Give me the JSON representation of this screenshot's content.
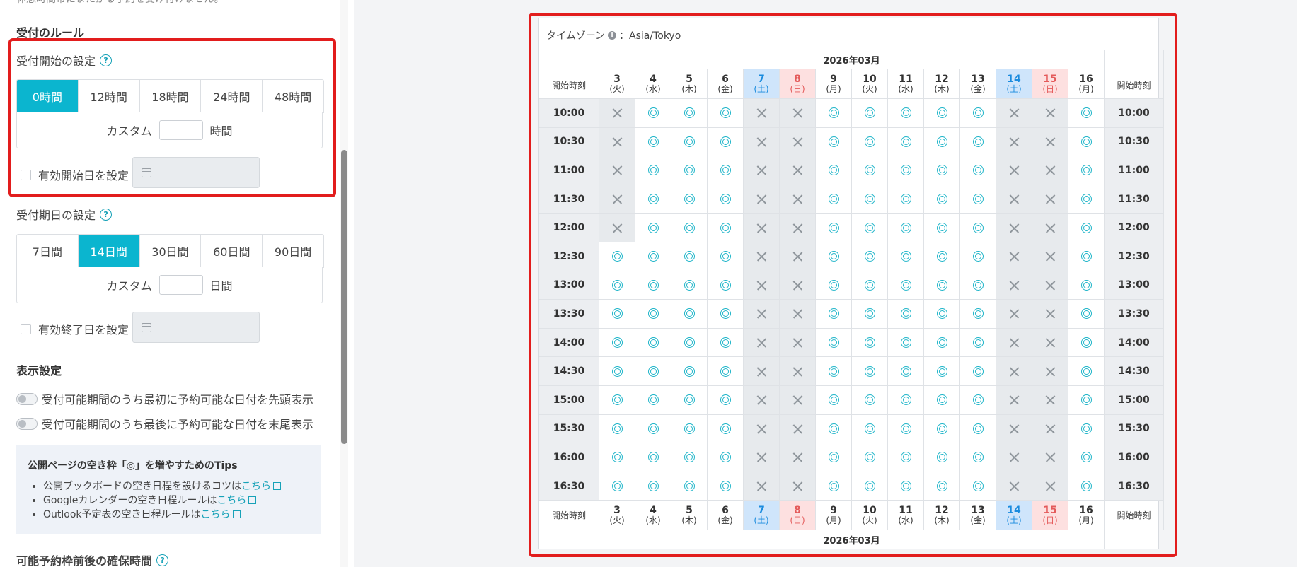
{
  "left": {
    "top_cut_text": "休憩時間帯にまたがる予約を受け付けません。",
    "rules_title": "受付のルール",
    "start": {
      "title": "受付開始の設定",
      "help": "?",
      "options": [
        "0時間",
        "12時間",
        "18時間",
        "24時間",
        "48時間"
      ],
      "active_index": 0,
      "custom_label": "カスタム",
      "custom_value": "",
      "custom_unit": "時間",
      "checkbox_label": "有効開始日を設定"
    },
    "end": {
      "title": "受付期日の設定",
      "help": "?",
      "options": [
        "7日間",
        "14日間",
        "30日間",
        "60日間",
        "90日間"
      ],
      "active_index": 1,
      "custom_label": "カスタム",
      "custom_value": "",
      "custom_unit": "日間",
      "checkbox_label": "有効終了日を設定"
    },
    "display": {
      "title": "表示設定",
      "toggle1": "受付可能期間のうち最初に予約可能な日付を先頭表示",
      "toggle2": "受付可能期間のうち最後に予約可能な日付を末尾表示"
    },
    "tips": {
      "title": "公開ページの空き枠「◎」を増やすためのTips",
      "items": [
        {
          "text": "公開ブックボードの空き日程を設けるコツは",
          "link": "こちら"
        },
        {
          "text": "Googleカレンダーの空き日程ルールは",
          "link": "こちら"
        },
        {
          "text": "Outlook予定表の空き日程ルールは",
          "link": "こちら"
        }
      ]
    },
    "buffer_title": "可能予約枠前後の確保時間",
    "buffer_help": "?"
  },
  "calendar": {
    "timezone_label": "タイムゾーン",
    "timezone_value": "：Asia/Tokyo",
    "month": "2026年03月",
    "start_label": "開始時刻",
    "days": [
      {
        "d": "3",
        "w": "(火)",
        "type": "weekday"
      },
      {
        "d": "4",
        "w": "(水)",
        "type": "weekday"
      },
      {
        "d": "5",
        "w": "(木)",
        "type": "weekday"
      },
      {
        "d": "6",
        "w": "(金)",
        "type": "weekday"
      },
      {
        "d": "7",
        "w": "(土)",
        "type": "sat"
      },
      {
        "d": "8",
        "w": "(日)",
        "type": "sun"
      },
      {
        "d": "9",
        "w": "(月)",
        "type": "weekday"
      },
      {
        "d": "10",
        "w": "(火)",
        "type": "weekday"
      },
      {
        "d": "11",
        "w": "(水)",
        "type": "weekday"
      },
      {
        "d": "12",
        "w": "(木)",
        "type": "weekday"
      },
      {
        "d": "13",
        "w": "(金)",
        "type": "weekday"
      },
      {
        "d": "14",
        "w": "(土)",
        "type": "sat"
      },
      {
        "d": "15",
        "w": "(日)",
        "type": "sun"
      },
      {
        "d": "16",
        "w": "(月)",
        "type": "weekday"
      }
    ],
    "times": [
      "10:00",
      "10:30",
      "11:00",
      "11:30",
      "12:00",
      "12:30",
      "13:00",
      "13:30",
      "14:00",
      "14:30",
      "15:00",
      "15:30",
      "16:00",
      "16:30"
    ],
    "availability": [
      "x◎◎◎xx◎◎◎◎◎xx◎",
      "x◎◎◎xx◎◎◎◎◎xx◎",
      "x◎◎◎xx◎◎◎◎◎xx◎",
      "x◎◎◎xx◎◎◎◎◎xx◎",
      "x◎◎◎xx◎◎◎◎◎xx◎",
      "◎◎◎◎xx◎◎◎◎◎xx◎",
      "◎◎◎◎xx◎◎◎◎◎xx◎",
      "◎◎◎◎xx◎◎◎◎◎xx◎",
      "◎◎◎◎xx◎◎◎◎◎xx◎",
      "◎◎◎◎xx◎◎◎◎◎xx◎",
      "◎◎◎◎xx◎◎◎◎◎xx◎",
      "◎◎◎◎xx◎◎◎◎◎xx◎",
      "◎◎◎◎xx◎◎◎◎◎xx◎",
      "◎◎◎◎xx◎◎◎◎◎xx◎"
    ]
  },
  "colors": {
    "accent": "#0bb5cf",
    "highlight": "#e21d1d",
    "saturday": "#1a8bde",
    "sunday": "#e45a5a"
  }
}
